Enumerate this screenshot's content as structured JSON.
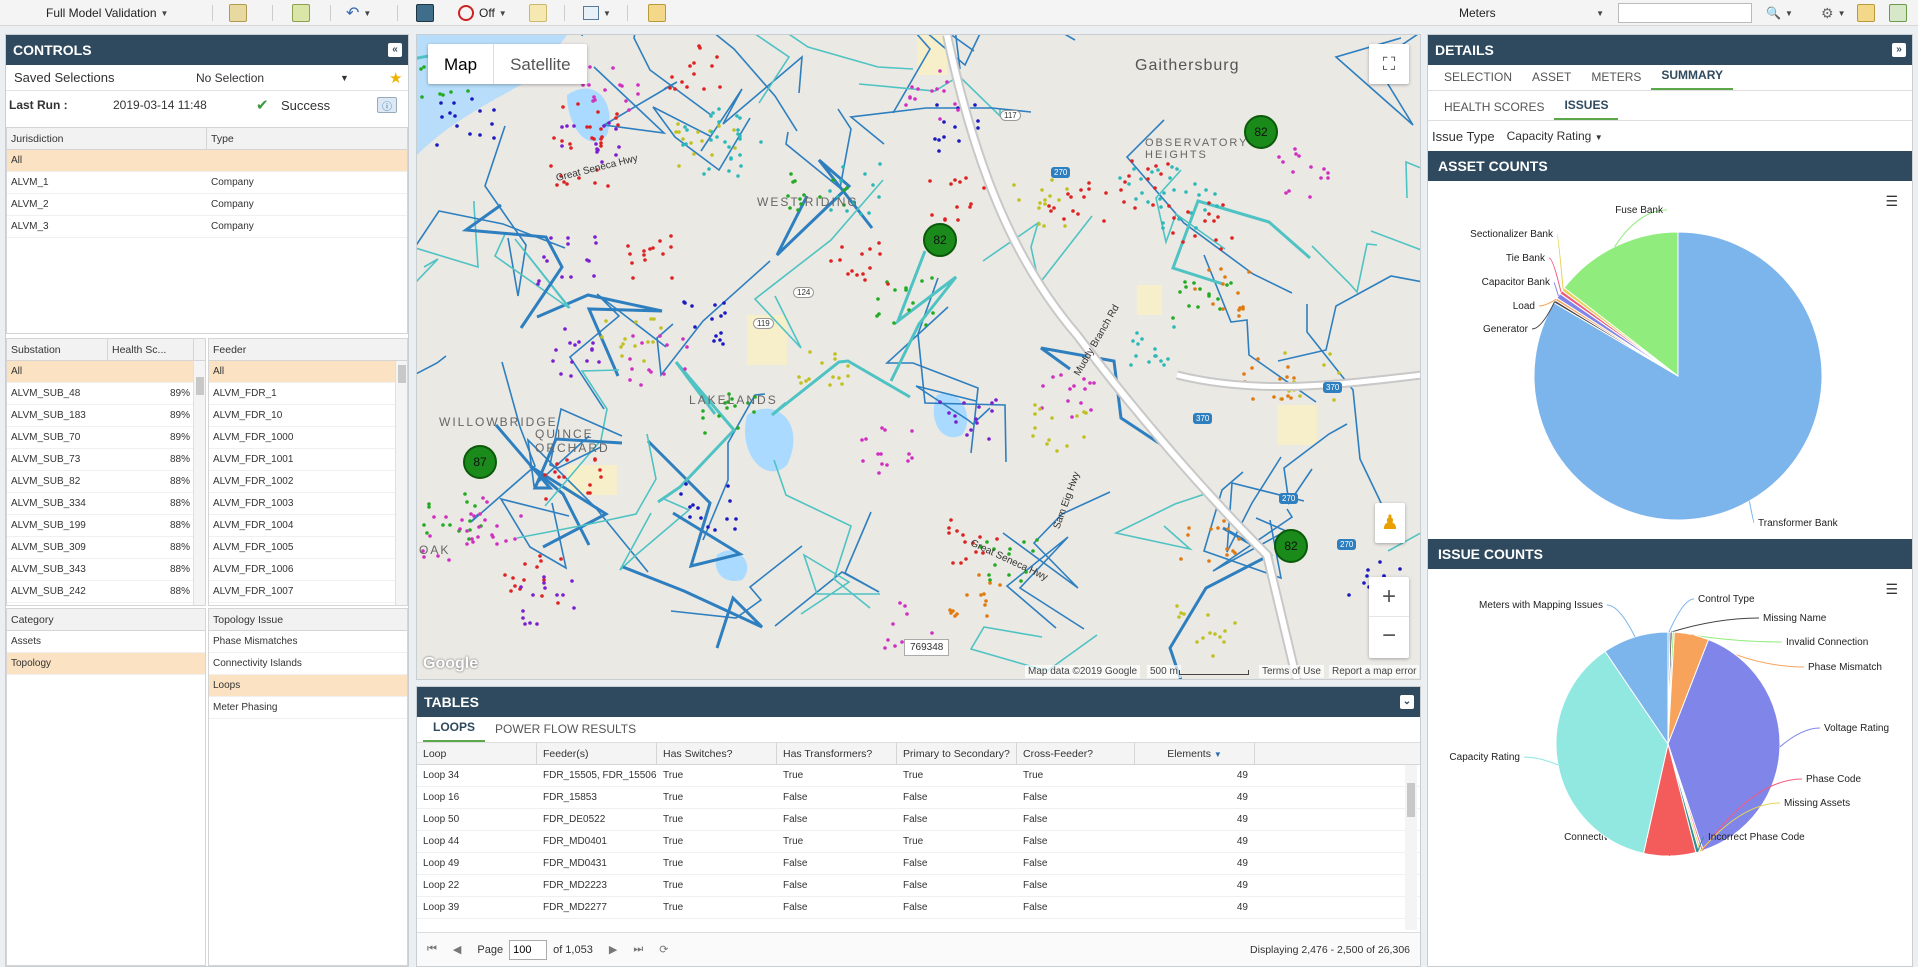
{
  "toolbar": {
    "validation_select": "Full Model Validation",
    "filter_state": "Off",
    "search_scope": "Meters",
    "search_placeholder": ""
  },
  "controls": {
    "title": "CONTROLS",
    "saved_selections_label": "Saved Selections",
    "saved_selections_value": "No Selection",
    "last_run_label": "Last Run :",
    "last_run_value": "2019-03-14 11:48",
    "status": "Success",
    "jurisdiction_grid": {
      "headers": [
        "Jurisdiction",
        "Type"
      ],
      "rows": [
        [
          "All",
          ""
        ],
        [
          "ALVM_1",
          "Company"
        ],
        [
          "ALVM_2",
          "Company"
        ],
        [
          "ALVM_3",
          "Company"
        ]
      ]
    },
    "substation_grid": {
      "headers": [
        "Substation",
        "Health Sc..."
      ],
      "rows": [
        [
          "All",
          ""
        ],
        [
          "ALVM_SUB_48",
          "89%"
        ],
        [
          "ALVM_SUB_183",
          "89%"
        ],
        [
          "ALVM_SUB_70",
          "89%"
        ],
        [
          "ALVM_SUB_73",
          "88%"
        ],
        [
          "ALVM_SUB_82",
          "88%"
        ],
        [
          "ALVM_SUB_334",
          "88%"
        ],
        [
          "ALVM_SUB_199",
          "88%"
        ],
        [
          "ALVM_SUB_309",
          "88%"
        ],
        [
          "ALVM_SUB_343",
          "88%"
        ],
        [
          "ALVM_SUB_242",
          "88%"
        ]
      ]
    },
    "feeder_grid": {
      "headers": [
        "Feeder"
      ],
      "rows": [
        "All",
        "ALVM_FDR_1",
        "ALVM_FDR_10",
        "ALVM_FDR_1000",
        "ALVM_FDR_1001",
        "ALVM_FDR_1002",
        "ALVM_FDR_1003",
        "ALVM_FDR_1004",
        "ALVM_FDR_1005",
        "ALVM_FDR_1006",
        "ALVM_FDR_1007"
      ]
    },
    "category_grid": {
      "headers": [
        "Category"
      ],
      "rows": [
        "Assets",
        "Topology"
      ]
    },
    "topology_grid": {
      "headers": [
        "Topology Issue"
      ],
      "rows": [
        "Phase Mismatches",
        "Connectivity Islands",
        "Loops",
        "Meter Phasing"
      ]
    }
  },
  "map": {
    "tab_map": "Map",
    "tab_satellite": "Satellite",
    "attribution": "Map data ©2019 Google",
    "scale": "500 m",
    "terms": "Terms of Use",
    "report": "Report a map error",
    "google": "Google",
    "tooltip": "769348",
    "place_labels": [
      "Gaithersburg",
      "OBSERVATORY HEIGHTS",
      "WEST RIDING",
      "LAKELANDS",
      "WILLOWBRIDGE",
      "QUINCE ORCHARD",
      "OAK",
      "Great Seneca Hwy",
      "Muddy Branch Rd",
      "Sam Eig Hwy",
      "Great Seneca Hwy"
    ],
    "route_labels": [
      "117",
      "270",
      "124",
      "119",
      "370",
      "370",
      "270",
      "270"
    ],
    "clusters": [
      "82",
      "82",
      "87",
      "82"
    ]
  },
  "tables": {
    "title": "TABLES",
    "tabs": [
      "LOOPS",
      "POWER FLOW RESULTS"
    ],
    "headers": [
      "Loop",
      "Feeder(s)",
      "Has Switches?",
      "Has Transformers?",
      "Primary to Secondary?",
      "Cross-Feeder?",
      "Elements"
    ],
    "rows": [
      [
        "Loop 34",
        "FDR_15505, FDR_15506, F",
        "True",
        "True",
        "True",
        "True",
        "49"
      ],
      [
        "Loop 16",
        "FDR_15853",
        "True",
        "False",
        "False",
        "False",
        "49"
      ],
      [
        "Loop 50",
        "FDR_DE0522",
        "True",
        "False",
        "False",
        "False",
        "49"
      ],
      [
        "Loop 44",
        "FDR_MD0401",
        "True",
        "True",
        "True",
        "False",
        "49"
      ],
      [
        "Loop 49",
        "FDR_MD0431",
        "True",
        "False",
        "False",
        "False",
        "49"
      ],
      [
        "Loop 22",
        "FDR_MD2223",
        "True",
        "False",
        "False",
        "False",
        "49"
      ],
      [
        "Loop 39",
        "FDR_MD2277",
        "True",
        "False",
        "False",
        "False",
        "49"
      ]
    ],
    "pager": {
      "page_label": "Page",
      "page_value": "100",
      "of_label": "of 1,053",
      "displaying": "Displaying 2,476 - 2,500 of 26,306"
    }
  },
  "details": {
    "title": "DETAILS",
    "tabs": [
      "SELECTION",
      "ASSET",
      "METERS",
      "SUMMARY"
    ],
    "subtabs": [
      "HEALTH SCORES",
      "ISSUES"
    ],
    "issue_type_label": "Issue Type",
    "issue_type_value": "Capacity Rating",
    "asset_counts_title": "ASSET COUNTS",
    "issue_counts_title": "ISSUE COUNTS"
  },
  "chart_data": [
    {
      "type": "pie",
      "title": "",
      "series": [
        {
          "labels": [
            "Transformer Bank",
            "Generator",
            "Load",
            "Capacitor Bank",
            "Tie Bank",
            "Sectionalizer Bank",
            "Fuse Bank"
          ],
          "values": [
            83.5,
            0.3,
            0.3,
            0.6,
            0.4,
            0.4,
            14.5
          ],
          "colors": [
            "#7cb5ec",
            "#434348",
            "#f7a35c",
            "#8085e9",
            "#f15c80",
            "#e4d354",
            "#90ed7d"
          ]
        }
      ]
    },
    {
      "type": "pie",
      "title": "",
      "series": [
        {
          "labels": [
            "Control Type",
            "Missing Name",
            "Invalid Connection",
            "Phase Mismatch",
            "Voltage Rating",
            "Phase Code",
            "Missing Assets",
            "Incorrect Phase Code",
            "Connectivity Island",
            "Capacity Rating",
            "Meters with Mapping Issues"
          ],
          "values": [
            0.3,
            0.3,
            0.3,
            5.0,
            39.0,
            0.3,
            0.3,
            0.5,
            7.5,
            37.0,
            9.5
          ],
          "colors": [
            "#7cb5ec",
            "#434348",
            "#90ed7d",
            "#f7a35c",
            "#8085e9",
            "#f15c80",
            "#e4d354",
            "#2b908f",
            "#f45b5b",
            "#91e8e1",
            "#7cb5ec"
          ]
        }
      ]
    }
  ]
}
